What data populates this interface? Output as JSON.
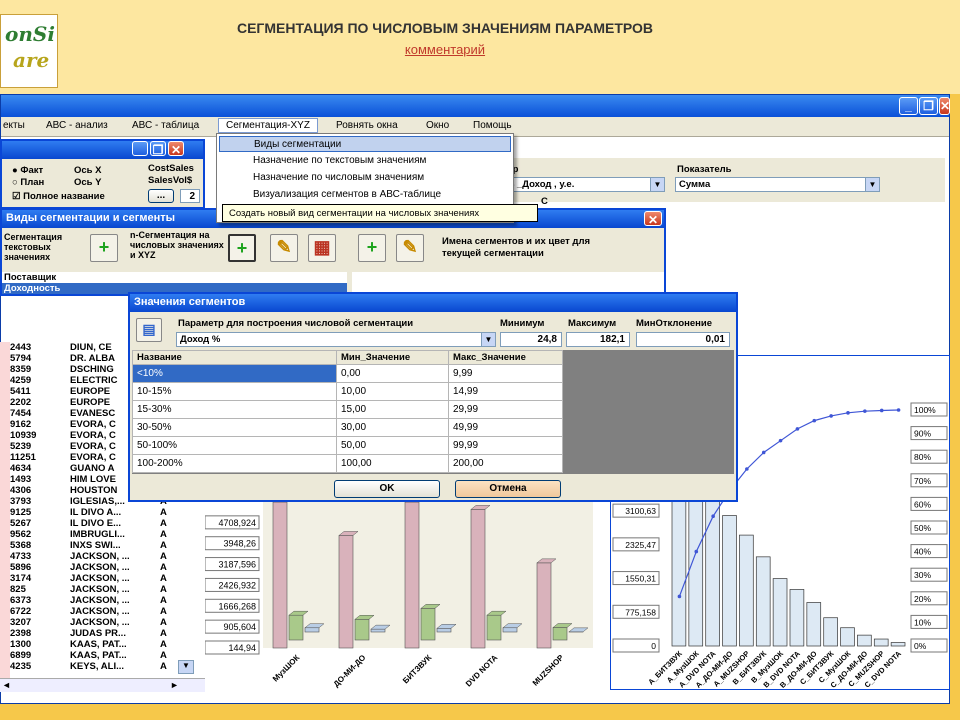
{
  "banner": {
    "logo_line1": "onSi",
    "logo_line2": "are",
    "title": "СЕГМЕНТАЦИЯ ПО ЧИСЛОВЫМ ЗНАЧЕНИЯМ ПАРАМЕТРОВ",
    "comment_link": "комментарий"
  },
  "window": {
    "minimize": "_",
    "restore": "❐",
    "close": "✕"
  },
  "menu": {
    "items": [
      "екты",
      "АВС - анализ",
      "АВС - таблица",
      "Сегментация-XYZ",
      "Ровнять окна",
      "Окно",
      "Помощь"
    ],
    "dropdown": [
      "Виды сегментации",
      "Назначение по текстовым значениям",
      "Назначение по числовым значениям",
      "Визуализация сегментов в АВС-таблице"
    ],
    "tooltip": "Создать новый вид сегментации на числовых значениях"
  },
  "params": {
    "radio_fact": "Факт",
    "radio_plan": "План",
    "checkbox_fullname": "Полное название",
    "axis_x": "Ось X",
    "axis_y": "Ось Y",
    "cost_sales": "CostSales",
    "sales_vol": "SalesVol$",
    "ellipsis": "...",
    "num": "2",
    "filter_label": "тр",
    "filter_value": "$   _Доход , у.е.",
    "indicator_label": "Показатель",
    "indicator_value": "Сумма",
    "c_label": "С"
  },
  "segTypes": {
    "title": "Виды сегментации и сегменты",
    "text_seg": "Сегментация текстовых значениях",
    "num_seg": "n-Сегментация на числовых значениях и XYZ",
    "list": [
      "Поставщик",
      "Доходность"
    ],
    "seg_names_label": "Имена сегментов и их цвет для текущей сегментации"
  },
  "segDialog": {
    "title": "Значения сегментов",
    "param_label": "Параметр для построения числовой сегментации",
    "param_value": "Доход %",
    "min_label": "Минимум",
    "max_label": "Максимум",
    "dev_label": "МинОтклонение",
    "min_value": "24,8",
    "max_value": "182,1",
    "dev_value": "0,01",
    "columns": [
      "Название",
      "Мин_Значение",
      "Макс_Значение"
    ],
    "rows": [
      [
        "<10%",
        "0,00",
        "9,99"
      ],
      [
        "10-15%",
        "10,00",
        "14,99"
      ],
      [
        "15-30%",
        "15,00",
        "29,99"
      ],
      [
        "30-50%",
        "30,00",
        "49,99"
      ],
      [
        "50-100%",
        "50,00",
        "99,99"
      ],
      [
        "100-200%",
        "100,00",
        "200,00"
      ]
    ],
    "ok": "OK",
    "cancel": "Отмена"
  },
  "suppliers": [
    [
      "2443",
      "DIUN, CE"
    ],
    [
      "5794",
      "DR. ALBA"
    ],
    [
      "8359",
      "DSCHING"
    ],
    [
      "4259",
      "ELECTRIC"
    ],
    [
      "5411",
      "EUROPE"
    ],
    [
      "2202",
      "EUROPE"
    ],
    [
      "7454",
      "EVANESC"
    ],
    [
      "9162",
      "EVORA, C"
    ],
    [
      "10939",
      "EVORA, C"
    ],
    [
      "5239",
      "EVORA, C"
    ],
    [
      "11251",
      "EVORA, C"
    ],
    [
      "4634",
      "GUANO A"
    ],
    [
      "1493",
      "HIM LOVE"
    ],
    [
      "4306",
      "HOUSTON"
    ],
    [
      "3793",
      "IGLESIAS,..."
    ],
    [
      "9125",
      "IL DIVO A..."
    ],
    [
      "5267",
      "IL DIVO E..."
    ],
    [
      "9562",
      "IMBRUGLI..."
    ],
    [
      "5368",
      "INXS SWI..."
    ],
    [
      "4733",
      "JACKSON, ..."
    ],
    [
      "5896",
      "JACKSON, ..."
    ],
    [
      "3174",
      "JACKSON, ..."
    ],
    [
      "825",
      "JACKSON, ..."
    ],
    [
      "6373",
      "JACKSON, ..."
    ],
    [
      "6722",
      "JACKSON, ..."
    ],
    [
      "3207",
      "JACKSON, ..."
    ],
    [
      "2398",
      "JUDAS PR..."
    ],
    [
      "1300",
      "KAAS, PAT..."
    ],
    [
      "6899",
      "KAAS, PAT..."
    ],
    [
      "4235",
      "KEYS, ALI..."
    ]
  ],
  "supplier_class": "А",
  "chart_data": [
    {
      "type": "bar",
      "categories": [
        "МузШОК",
        "ДО-МИ-ДО",
        "БИТЗВУК",
        "DVD NOTA",
        "MUZSHOP"
      ],
      "y_ticks": [
        "144,94",
        "905,604",
        "1666,268",
        "2426,932",
        "3187,596",
        "3948,26",
        "4708,924"
      ],
      "series": [
        {
          "values": [
            6100,
            4250,
            6100,
            5200,
            3250
          ]
        },
        {
          "values": [
            1050,
            900,
            1300,
            1050,
            600
          ]
        },
        {
          "values": [
            300,
            250,
            280,
            300,
            150
          ]
        }
      ],
      "ylim": [
        144.94,
        5469.588
      ]
    },
    {
      "type": "bar",
      "categories": [
        "А_БИТЗВУК",
        "А_МузШОК",
        "А_DVD NOTA",
        "А_ДО-МИ-ДО",
        "А_MUZSHOP",
        "В_БИТЗВУК",
        "В_МузШОК",
        "В_DVD NOTA",
        "В_ДО-МИ-ДО",
        "С_БИТЗВУК",
        "С_МузШОК",
        "С_ДО-МИ-ДО",
        "С_MUZSHOP",
        "С_DVD NOTA"
      ],
      "y_ticks": [
        "0",
        "775,158",
        "1550,31",
        "2325,47",
        "3100,63",
        "3875,79",
        "4650,94"
      ],
      "pct_ticks": [
        "0%",
        "10%",
        "20%",
        "30%",
        "40%",
        "50%",
        "60%",
        "70%",
        "80%",
        "90%",
        "100%"
      ],
      "values": [
        6050,
        5000,
        4200,
        3000,
        2550,
        2050,
        1550,
        1300,
        1000,
        650,
        420,
        250,
        160,
        80
      ],
      "cumulative_pct": [
        21,
        40,
        55,
        66,
        75,
        82,
        87,
        92,
        95.5,
        97.5,
        98.8,
        99.5,
        99.8,
        100
      ],
      "ylim": [
        0,
        5426.1
      ]
    }
  ],
  "colors": {
    "banner_bg": "#fde7a0",
    "page_bg": "#f6c84a",
    "titlebar": "#0a50d8",
    "bar_pink": "#d9b2bb",
    "bar_green": "#a9c98a",
    "bar_blue": "#b9cde5",
    "pareto_bar": "#dde9f4",
    "pareto_line": "#3f56d6"
  }
}
